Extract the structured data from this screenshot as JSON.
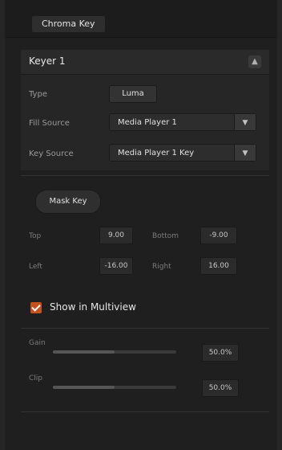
{
  "panel": {
    "title": "Chroma Key"
  },
  "section": {
    "title": "Keyer 1",
    "toggle": "▲"
  },
  "key": {
    "type_label": "Type",
    "type_value": "Luma",
    "fill_label": "Fill Source",
    "fill_value": "Media Player 1",
    "key_label": "Key Source",
    "key_value": "Media Player 1 Key"
  },
  "mask": {
    "title": "Mask Key",
    "top_label": "Top",
    "top_value": "9.00",
    "bottom_label": "Bottom",
    "bottom_value": "-9.00",
    "left_label": "Left",
    "left_value": "-16.00",
    "right_label": "Right",
    "right_value": "16.00"
  },
  "preview": {
    "checked": true,
    "label": "Show in Multiview",
    "row1_label": "Gain",
    "row1_value": "50.0%",
    "row1_level": 0.5,
    "row2_label": "Clip",
    "row2_value": "50.0%",
    "row2_level": 0.5
  },
  "colors": {
    "accent": "#c4521f"
  }
}
